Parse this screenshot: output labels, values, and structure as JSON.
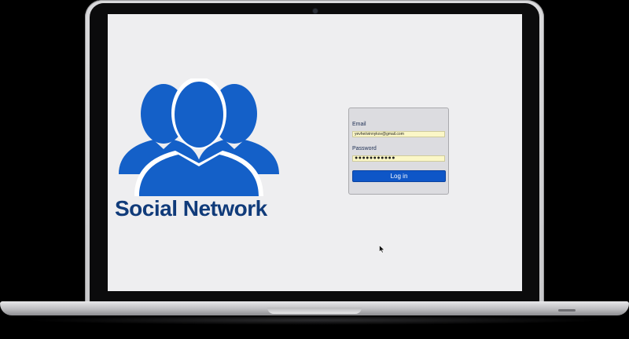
{
  "brand": {
    "title": "Social Network",
    "logo_icon": "users-group-icon",
    "color": "#103b7a",
    "icon_color": "#1460c8"
  },
  "login": {
    "email_label": "Email",
    "email_value": "yevheiivinnykov@gmail.com",
    "password_label": "Password",
    "password_value": "●●●●●●●●●●●",
    "button_label": "Log in",
    "button_color": "#0e56c7",
    "input_bg": "#fbf7c7"
  },
  "device": {
    "frame": "laptop",
    "camera_icon": "camera-dot-icon",
    "pointer_icon": "mouse-pointer-icon"
  }
}
